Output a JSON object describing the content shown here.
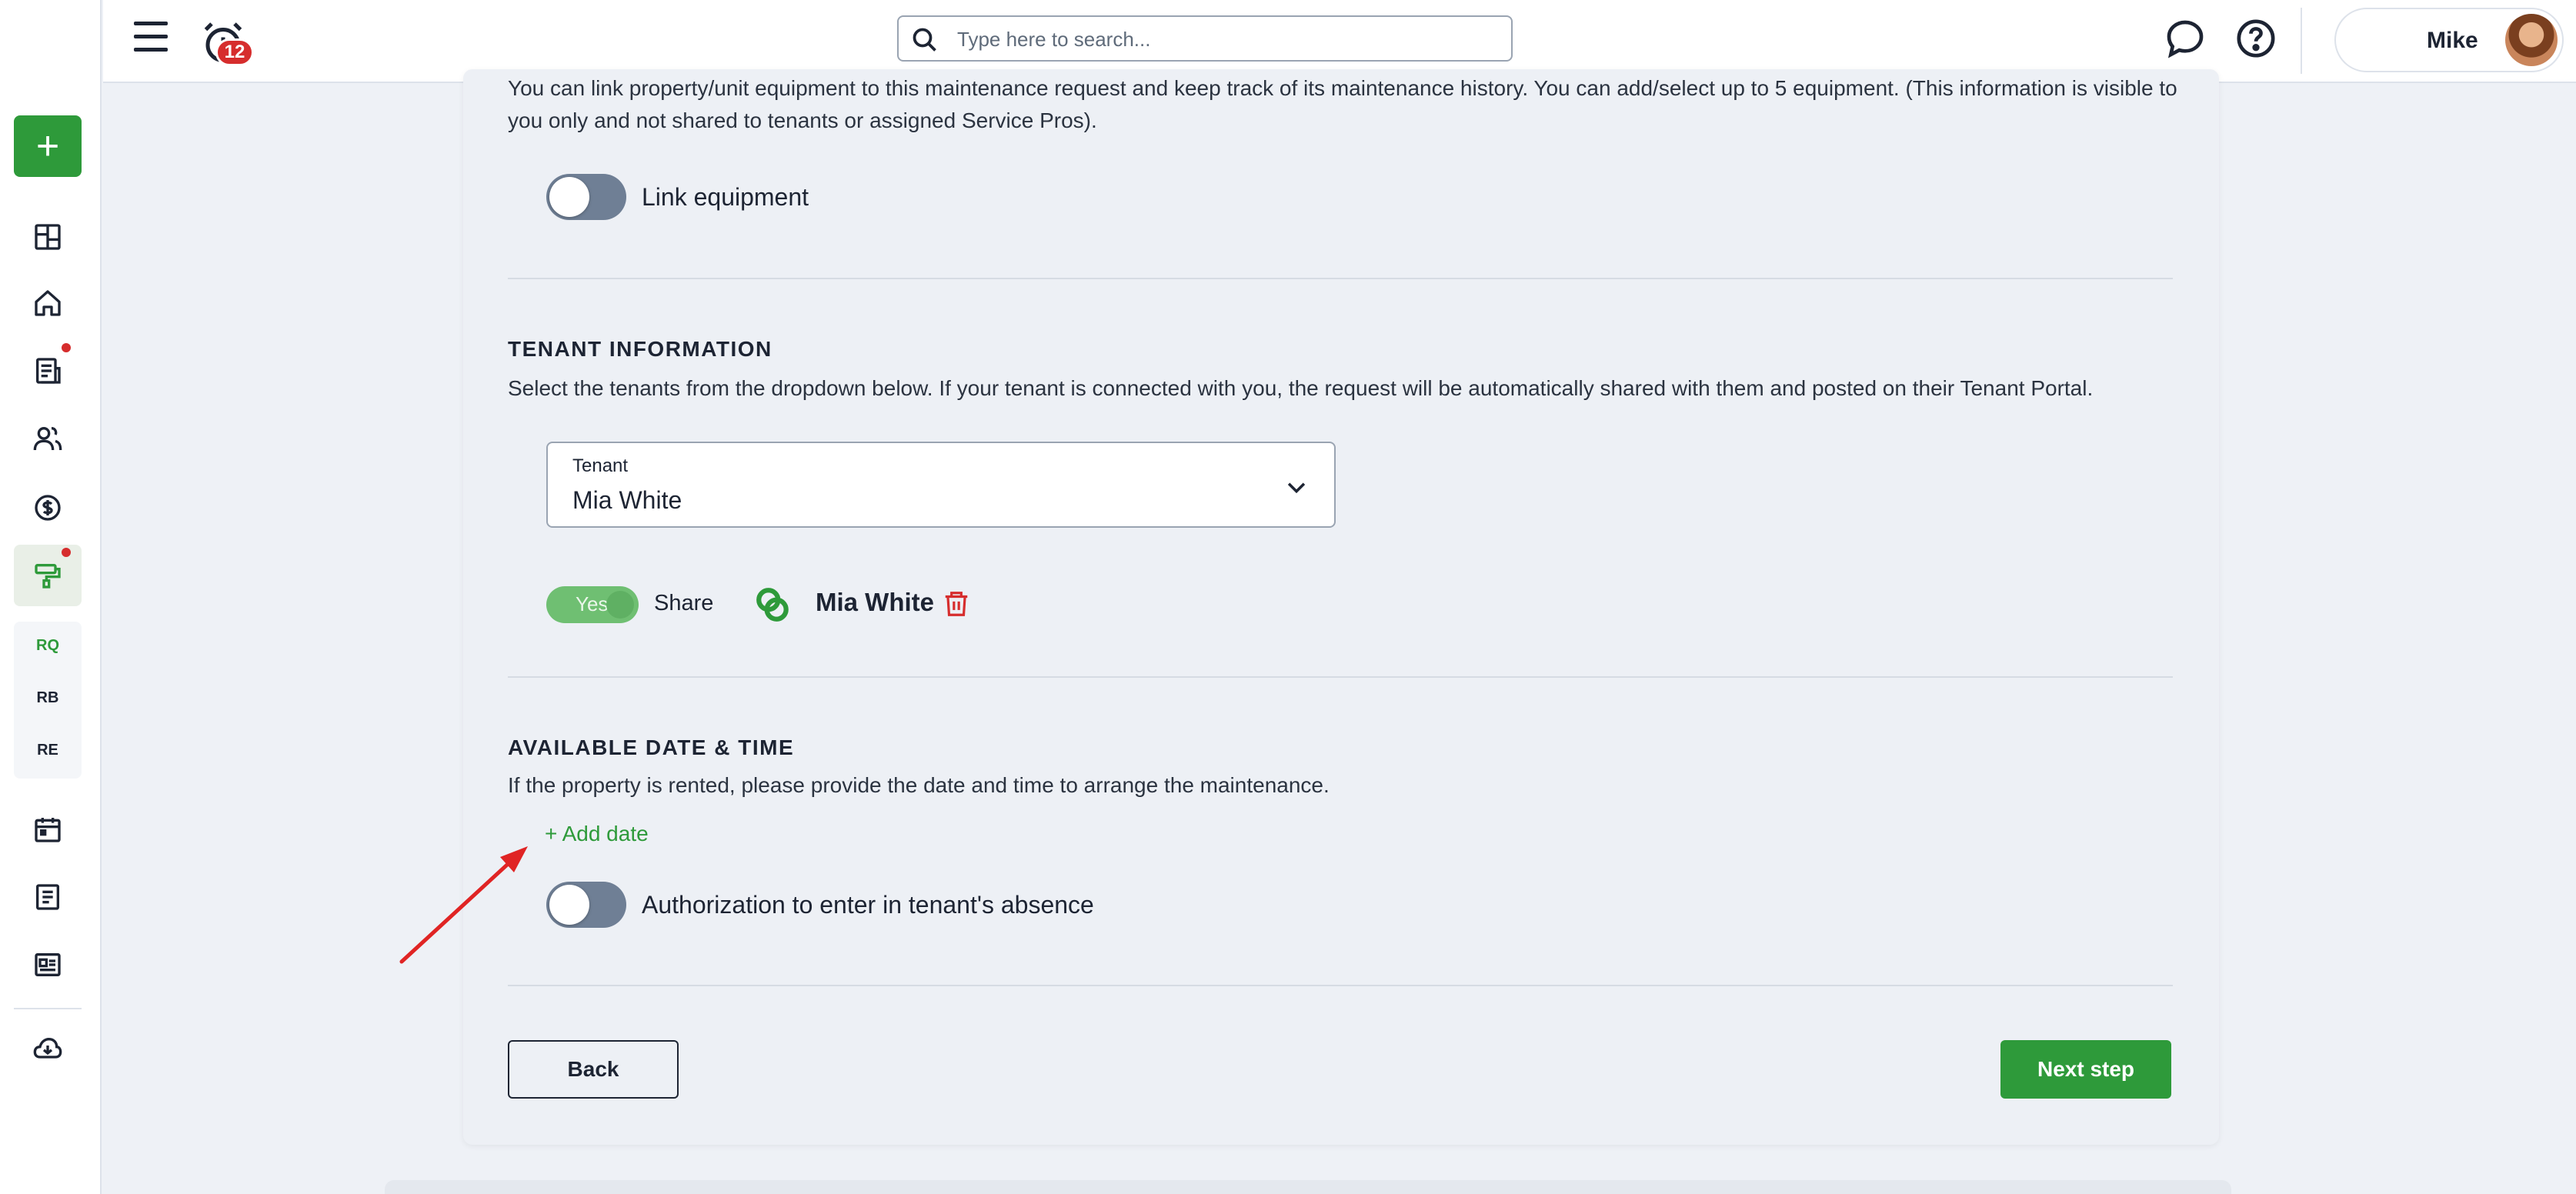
{
  "topbar": {
    "notification_count": "12",
    "search_placeholder": "Type here to search...",
    "user_name": "Mike"
  },
  "sidebar": {
    "add_label": "+",
    "text_items": [
      "RQ",
      "RB",
      "RE"
    ]
  },
  "equipment": {
    "description": "You can link property/unit equipment to this maintenance request and keep track of its maintenance history. You can add/select up to 5 equipment. (This information is visible to you only and not shared to tenants or assigned Service Pros).",
    "toggle_label": "Link equipment",
    "toggle_on": false
  },
  "tenant_info": {
    "heading": "TENANT INFORMATION",
    "description": "Select the tenants from the dropdown below. If your tenant is connected with you, the request will be automatically shared with them and posted on their Tenant Portal.",
    "select_label": "Tenant",
    "select_value": "Mia White",
    "share_toggle_text": "Yes",
    "share_label": "Share",
    "tenant_name": "Mia White"
  },
  "availability": {
    "heading": "AVAILABLE DATE & TIME",
    "description": "If the property is rented, please provide the date and time to arrange the maintenance.",
    "add_date_label": "+ Add date",
    "auth_toggle_label": "Authorization to enter in tenant's absence",
    "auth_toggle_on": false
  },
  "footer": {
    "back_label": "Back",
    "next_label": "Next step"
  },
  "colors": {
    "accent_green": "#2e9a3a",
    "alert_red": "#d62d2d",
    "toggle_off": "#6f7f95"
  }
}
